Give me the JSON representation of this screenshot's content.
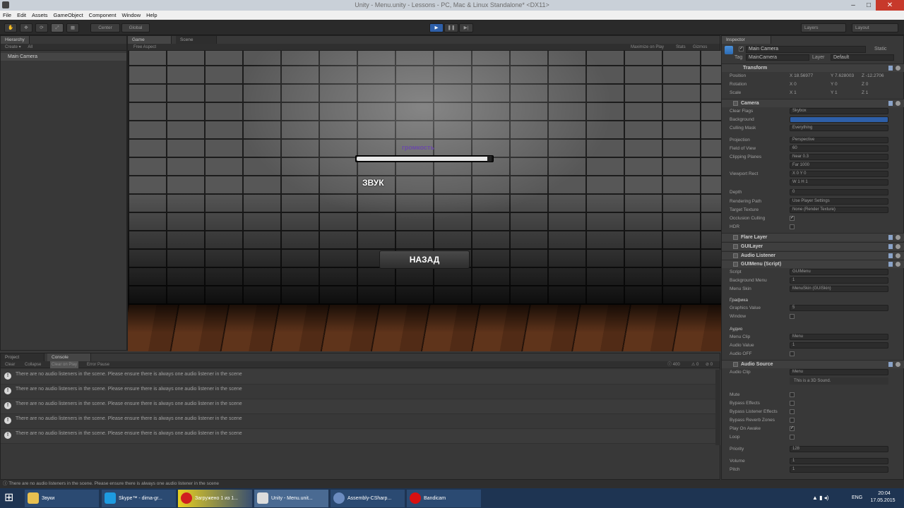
{
  "window": {
    "title": "Unity - Menu.unity - Lessons - PC, Mac & Linux Standalone* <DX11>"
  },
  "menu": [
    "File",
    "Edit",
    "Assets",
    "GameObject",
    "Component",
    "Window",
    "Help"
  ],
  "toolbar": {
    "pivot": "Center",
    "space": "Global",
    "layers": "Layers",
    "layout": "Layout"
  },
  "hierarchy": {
    "tab": "Hierarchy",
    "create": "Create",
    "search": "All",
    "items": [
      "Main Camera"
    ]
  },
  "game": {
    "tabs": [
      "Game",
      "Scene"
    ],
    "aspect": "Free Aspect",
    "options": [
      "Maximize on Play",
      "Stats",
      "Gizmos"
    ],
    "slider_label": "громкость",
    "volume_fraction": 0.98,
    "sound_label": "ЗВУК",
    "back_button": "НАЗАД"
  },
  "inspector": {
    "tab": "Inspector",
    "object_name": "Main Camera",
    "static": "Static",
    "tag_label": "Tag",
    "tag": "MainCamera",
    "layer_label": "Layer",
    "layer": "Default",
    "transform": {
      "title": "Transform",
      "rows": [
        {
          "label": "Position",
          "x": "18.56977",
          "y": "7.628003",
          "z": "-12.2706"
        },
        {
          "label": "Rotation",
          "x": "0",
          "y": "0",
          "z": "0"
        },
        {
          "label": "Scale",
          "x": "1",
          "y": "1",
          "z": "1"
        }
      ]
    },
    "camera": {
      "title": "Camera",
      "rows": [
        {
          "label": "Clear Flags",
          "value": "Skybox"
        },
        {
          "label": "Background",
          "value": ""
        },
        {
          "label": "Culling Mask",
          "value": "Everything"
        },
        {
          "label": "Projection",
          "value": "Perspective"
        },
        {
          "label": "Field of View",
          "value": "60"
        },
        {
          "label": "Clipping Planes",
          "value": "Near 0.3"
        },
        {
          "label": "",
          "value": "Far 1000"
        },
        {
          "label": "Viewport Rect",
          "value": "X 0   Y 0"
        },
        {
          "label": "",
          "value": "W 1   H 1"
        },
        {
          "label": "Depth",
          "value": "0"
        },
        {
          "label": "Rendering Path",
          "value": "Use Player Settings"
        },
        {
          "label": "Target Texture",
          "value": "None (Render Texture)"
        },
        {
          "label": "Occlusion Culling",
          "value": "✓"
        },
        {
          "label": "HDR",
          "value": ""
        }
      ]
    },
    "components": [
      "Flare Layer",
      "GUILayer",
      "Audio Listener",
      "GUIMenu (Script)"
    ],
    "script_rows": [
      {
        "label": "Script",
        "value": "GUIMenu"
      },
      {
        "label": "Background Menu",
        "value": "1"
      },
      {
        "label": "Menu Skin",
        "value": "MenuSkin (GUISkin)"
      }
    ],
    "graphics_title": "Графика",
    "graphics_rows": [
      {
        "label": "Graphics Value",
        "value": "5"
      },
      {
        "label": "Window",
        "value": ""
      }
    ],
    "audio_title": "Аудио",
    "audio_rows": [
      {
        "label": "Menu Clip",
        "value": "Menu"
      },
      {
        "label": "Audio Value",
        "value": "1"
      },
      {
        "label": "Audio OFF",
        "value": ""
      }
    ],
    "audio_source": {
      "title": "Audio Source",
      "clip_label": "Audio Clip",
      "clip": "Menu",
      "note": "This is a 3D Sound.",
      "rows": [
        {
          "label": "Mute",
          "value": ""
        },
        {
          "label": "Bypass Effects",
          "value": ""
        },
        {
          "label": "Bypass Listener Effects",
          "value": ""
        },
        {
          "label": "Bypass Reverb Zones",
          "value": ""
        },
        {
          "label": "Play On Awake",
          "value": "✓"
        },
        {
          "label": "Loop",
          "value": ""
        },
        {
          "label": "Priority",
          "value": "128"
        },
        {
          "label": "Volume",
          "value": "1"
        },
        {
          "label": "Pitch",
          "value": "1"
        }
      ]
    }
  },
  "console": {
    "tabs": [
      "Project",
      "Console"
    ],
    "buttons": [
      "Clear",
      "Collapse",
      "Clear on Play",
      "Error Pause"
    ],
    "counts": [
      "400",
      "0",
      "0"
    ],
    "messages": [
      "There are no audio listeners in the scene. Please ensure there is always one audio listener in the scene",
      "There are no audio listeners in the scene. Please ensure there is always one audio listener in the scene",
      "There are no audio listeners in the scene. Please ensure there is always one audio listener in the scene",
      "There are no audio listeners in the scene. Please ensure there is always one audio listener in the scene",
      "There are no audio listeners in the scene. Please ensure there is always one audio listener in the scene"
    ]
  },
  "status": "There are no audio listeners in the scene. Please ensure there is always one audio listener in the scene",
  "taskbar": {
    "items": [
      "Звуки",
      "Skype™ - dima-gr...",
      "Загружено 1 из 1...",
      "Unity - Menu.unit...",
      "Assembly-CSharp...",
      "Bandicam"
    ],
    "lang": "ENG",
    "time": "20:04",
    "date": "17.05.2015"
  },
  "colors": {
    "accent": "#2e5fa8",
    "background": "#383838",
    "taskbar": "#1e3452"
  }
}
